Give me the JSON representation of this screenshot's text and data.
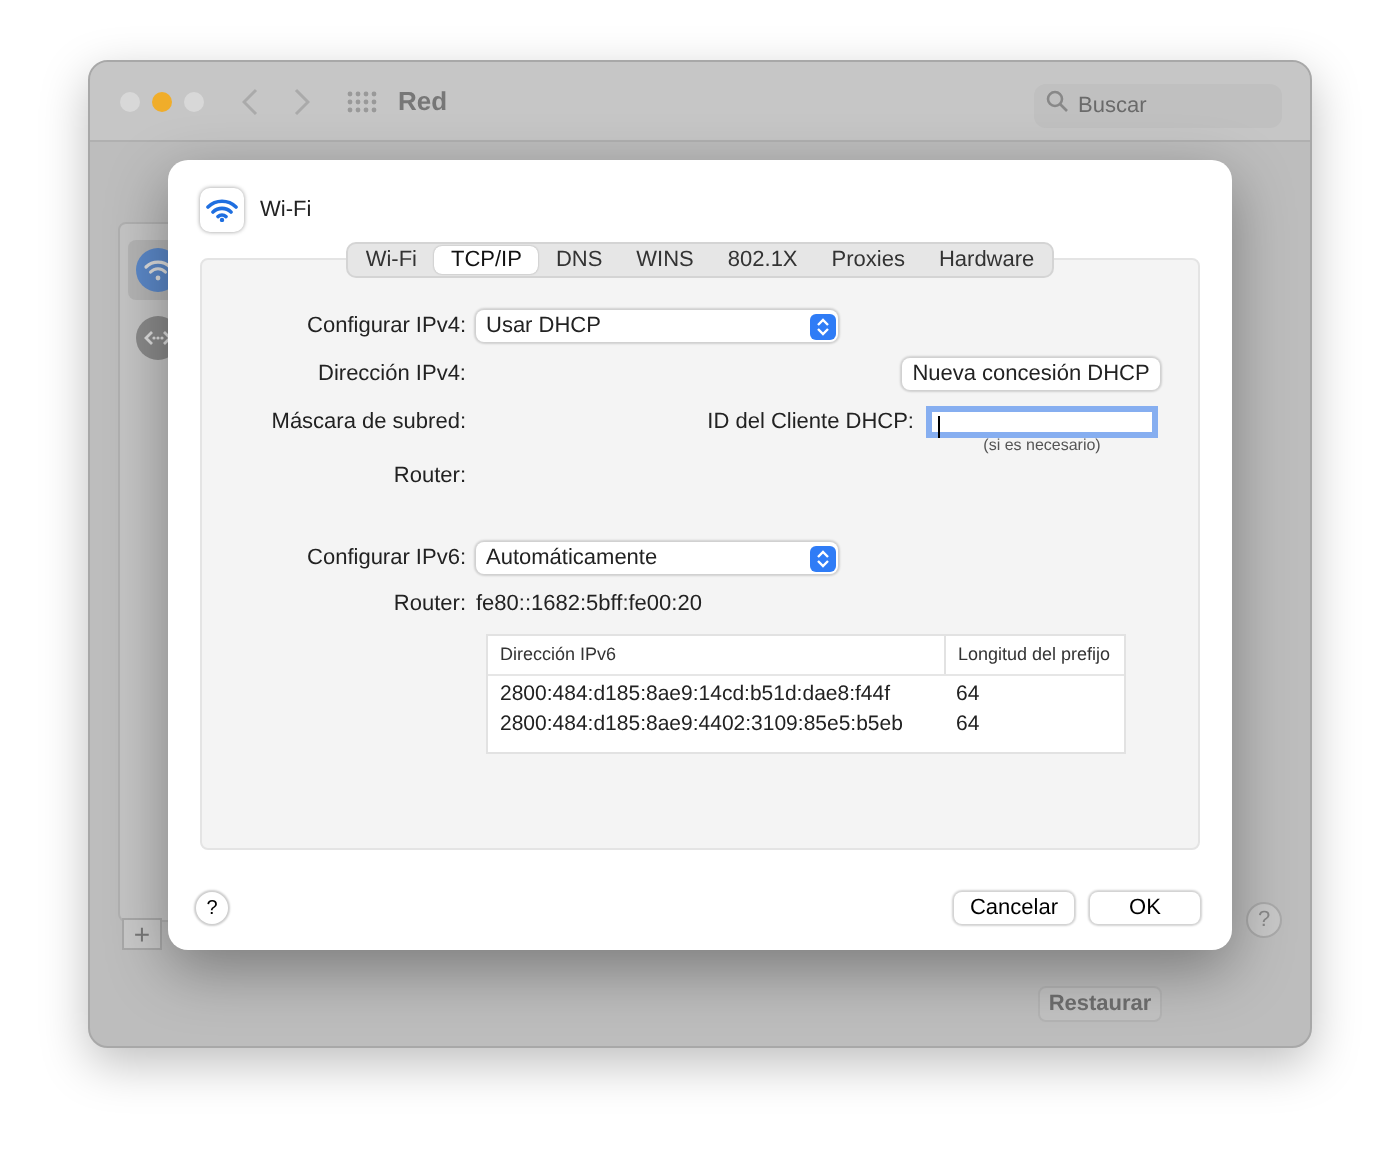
{
  "window": {
    "title": "Red",
    "search": {
      "placeholder": "Buscar"
    }
  },
  "sidebar": {
    "items": [
      {
        "kind": "wifi",
        "selected": true
      },
      {
        "kind": "ethernet",
        "selected": false
      }
    ],
    "add_button": "+"
  },
  "help_button": "?",
  "restore_button": "Restaurar",
  "sheet": {
    "title": "Wi-Fi",
    "tabs": [
      {
        "label": "Wi-Fi",
        "selected": false
      },
      {
        "label": "TCP/IP",
        "selected": true
      },
      {
        "label": "DNS",
        "selected": false
      },
      {
        "label": "WINS",
        "selected": false
      },
      {
        "label": "802.1X",
        "selected": false
      },
      {
        "label": "Proxies",
        "selected": false
      },
      {
        "label": "Hardware",
        "selected": false
      }
    ],
    "configure_ipv4": {
      "label": "Configurar IPv4:",
      "value": "Usar DHCP"
    },
    "ipv4_address": {
      "label": "Dirección IPv4:"
    },
    "renew_button": "Nueva concesión DHCP",
    "subnet_mask": {
      "label": "Máscara de subred:"
    },
    "dhcp_client_id": {
      "label": "ID del Cliente DHCP:",
      "hint": "(si es necesario)",
      "focused": true
    },
    "router_ipv4": {
      "label": "Router:"
    },
    "configure_ipv6": {
      "label": "Configurar IPv6:",
      "value": "Automáticamente"
    },
    "router_ipv6": {
      "label": "Router:",
      "value": "fe80::1682:5bff:fe00:20"
    },
    "ipv6_table": {
      "columns": [
        "Dirección IPv6",
        "Longitud del prefijo"
      ],
      "rows": [
        [
          "2800:484:d185:8ae9:14cd:b51d:dae8:f44f",
          "64"
        ],
        [
          "2800:484:d185:8ae9:4402:3109:85e5:b5eb",
          "64"
        ]
      ]
    },
    "help_button": "?",
    "buttons": [
      "Cancelar",
      "OK"
    ]
  }
}
